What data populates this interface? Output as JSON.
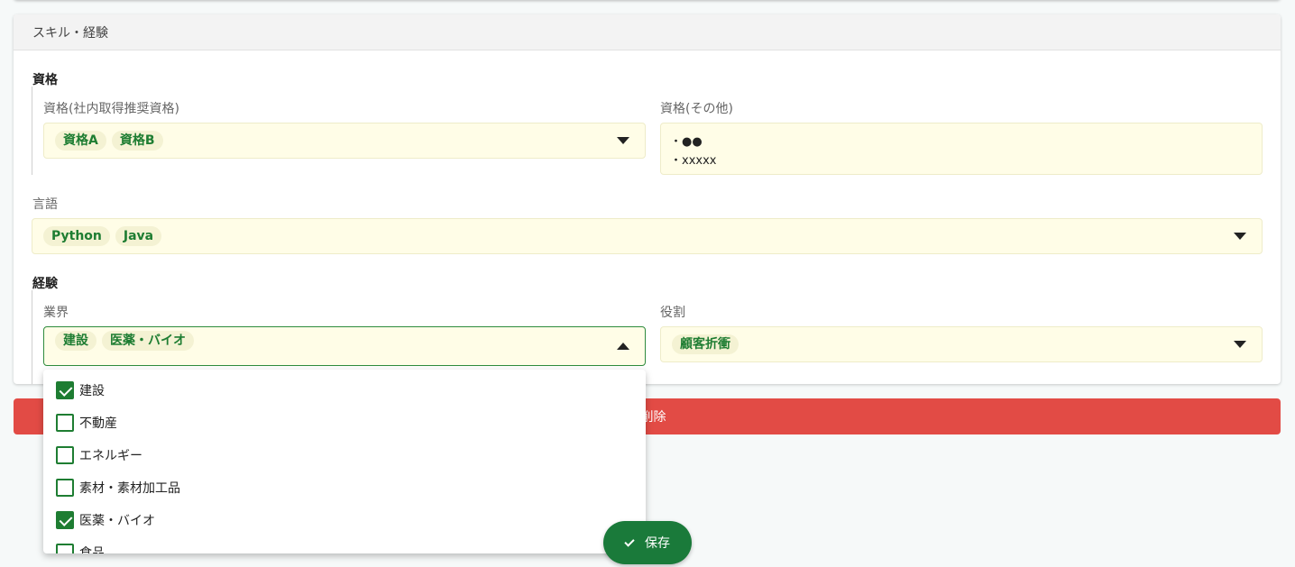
{
  "section": {
    "header": "スキル・経験",
    "qualifications_title": "資格",
    "experience_title": "経験"
  },
  "fields": {
    "qual_internal": {
      "label": "資格(社内取得推奨資格)",
      "chips": [
        "資格A",
        "資格B"
      ]
    },
    "qual_other": {
      "label": "資格(その他)",
      "lines": [
        "・●●",
        "・xxxxx"
      ]
    },
    "language": {
      "label": "言語",
      "chips": [
        "Python",
        "Java"
      ]
    },
    "industry": {
      "label": "業界",
      "chips": [
        "建設",
        "医薬・バイオ"
      ]
    },
    "role": {
      "label": "役割",
      "chips": [
        "顧客折衝"
      ]
    }
  },
  "delete_button": {
    "label": "ー削除"
  },
  "dropdown": {
    "items": [
      {
        "label": "建設",
        "checked": true
      },
      {
        "label": "不動産",
        "checked": false
      },
      {
        "label": "エネルギー",
        "checked": false
      },
      {
        "label": "素材・素材加工品",
        "checked": false
      },
      {
        "label": "医薬・バイオ",
        "checked": true
      },
      {
        "label": "食品",
        "checked": false
      }
    ]
  },
  "save_button": {
    "label": "保存"
  },
  "colors": {
    "accent": "#1a7a3a",
    "danger": "#e24b45",
    "field_bg": "#fffde7"
  }
}
